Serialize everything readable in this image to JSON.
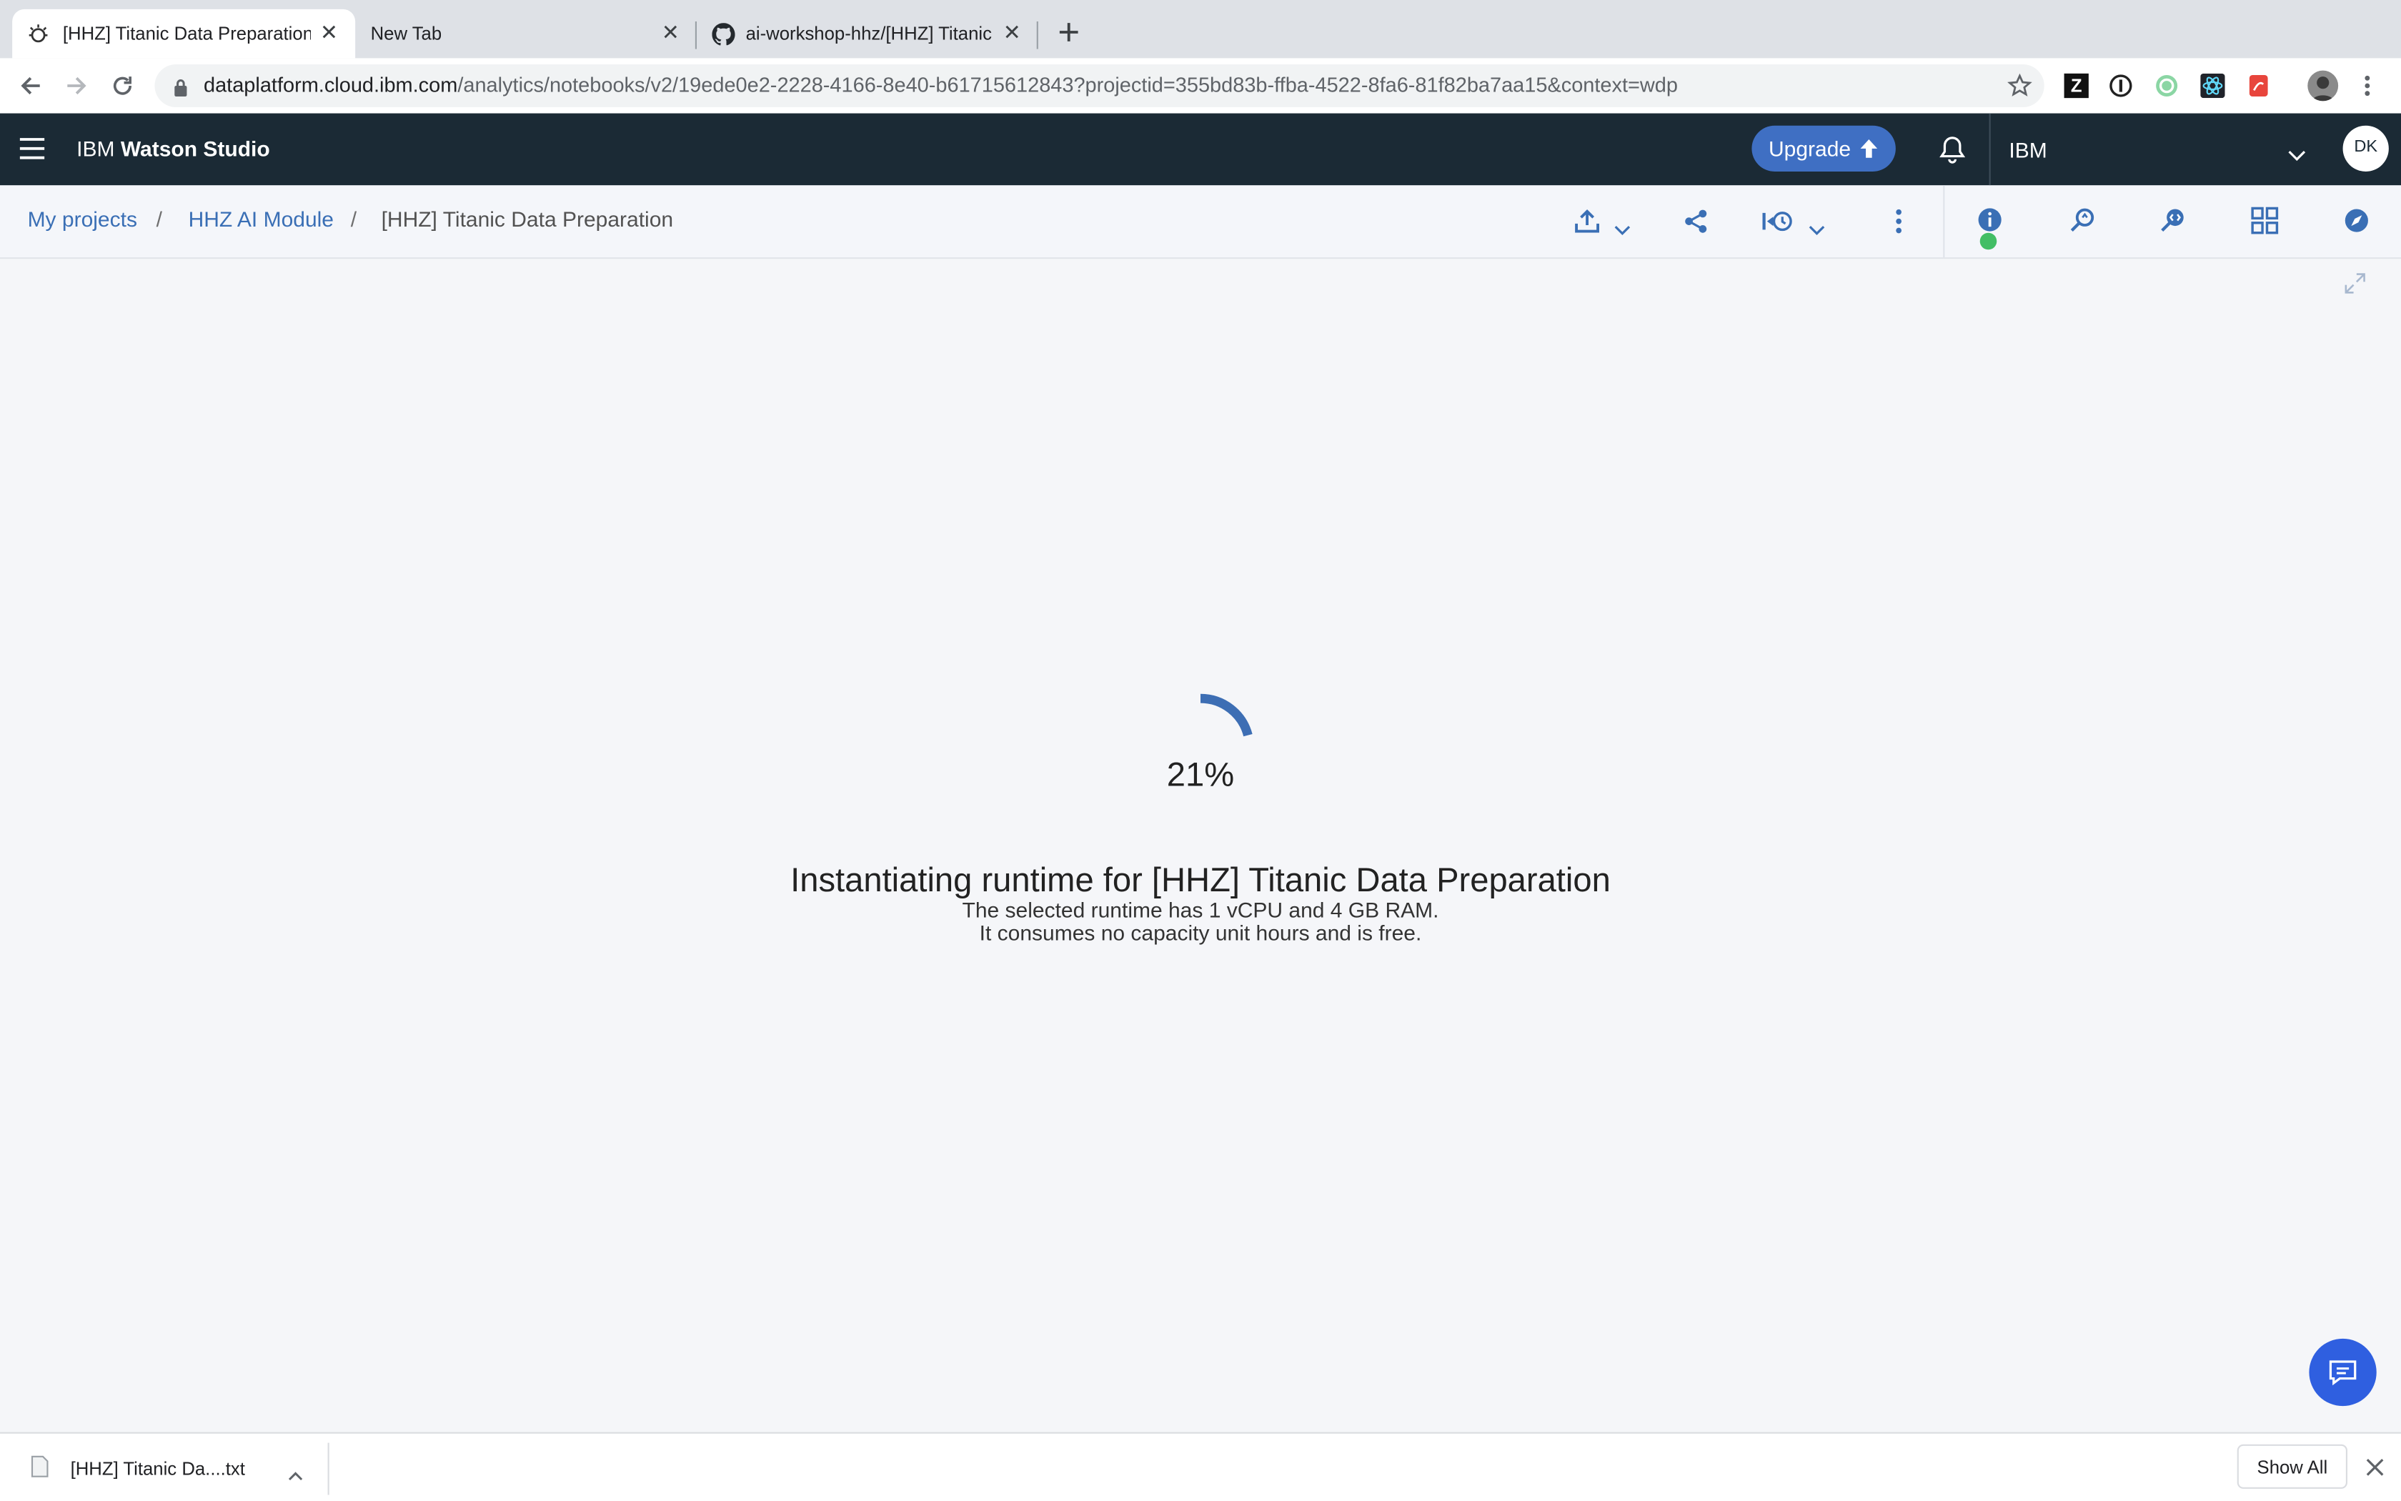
{
  "browser": {
    "tabs": [
      {
        "title": "[HHZ] Titanic Data Preparation -",
        "active": true
      },
      {
        "title": "New Tab",
        "active": false
      },
      {
        "title": "ai-workshop-hhz/[HHZ] Titanic D",
        "active": false
      }
    ],
    "url_host": "dataplatform.cloud.ibm.com",
    "url_path": "/analytics/notebooks/v2/19ede0e2-2228-4166-8e40-b61715612843?projectid=355bd83b-ffba-4522-8fa6-81f82ba7aa15&context=wdp"
  },
  "header": {
    "app_prefix": "IBM ",
    "app_name": "Watson Studio",
    "upgrade_label": "Upgrade",
    "account": "IBM",
    "avatar_initials": "DK"
  },
  "breadcrumb": {
    "items": [
      "My projects",
      "HHZ AI Module"
    ],
    "current": "[HHZ] Titanic Data Preparation"
  },
  "loading": {
    "progress_label": "21%",
    "progress": 0.21,
    "title": "Instantiating runtime for [HHZ] Titanic Data Preparation",
    "line1": "The selected runtime has 1 vCPU and 4 GB RAM.",
    "line2": "It consumes no capacity unit hours and is free."
  },
  "downloads": {
    "file_name": "[HHZ] Titanic Da....txt",
    "show_all_label": "Show All"
  },
  "colors": {
    "accent": "#3a6fb5",
    "header_bg": "#1b2a35",
    "status_dot": "#42be65"
  }
}
